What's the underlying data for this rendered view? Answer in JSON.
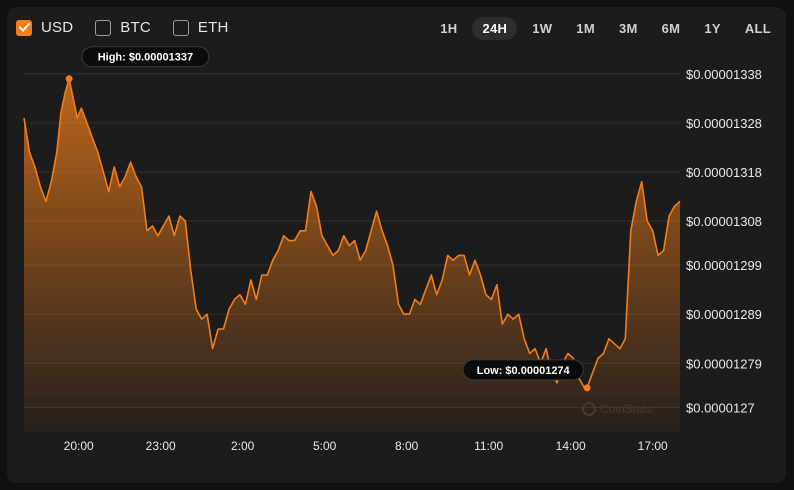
{
  "currencies": [
    {
      "label": "USD",
      "checked": true
    },
    {
      "label": "BTC",
      "checked": false
    },
    {
      "label": "ETH",
      "checked": false
    }
  ],
  "ranges": [
    "1H",
    "24H",
    "1W",
    "1M",
    "3M",
    "6M",
    "1Y",
    "ALL"
  ],
  "active_range": "24H",
  "watermark": "CoinStats",
  "colors": {
    "accent": "#f27e1a",
    "background": "#1c1c1c",
    "grid": "#2f2f2f"
  },
  "chart_data": {
    "type": "area",
    "y_tick_labels": [
      "$0.00001338",
      "$0.00001328",
      "$0.00001318",
      "$0.00001308",
      "$0.00001299",
      "$0.00001289",
      "$0.00001279",
      "$0.0000127"
    ],
    "y_tick_values": [
      1.338e-05,
      1.328e-05,
      1.318e-05,
      1.308e-05,
      1.299e-05,
      1.289e-05,
      1.279e-05,
      1.27e-05
    ],
    "x_tick_labels": [
      "20:00",
      "23:00",
      "2:00",
      "5:00",
      "8:00",
      "11:00",
      "14:00",
      "17:00"
    ],
    "x_tick_hours": [
      2,
      5,
      8,
      11,
      14,
      17,
      20,
      23
    ],
    "ylim": [
      1.265e-05,
      1.34e-05
    ],
    "xlim_hours": [
      0,
      24
    ],
    "grid": true,
    "high": {
      "label": "High: $0.00001337",
      "x_hours": 1.65,
      "value": 1.337e-05
    },
    "low": {
      "label": "Low: $0.00001274",
      "x_hours": 20.6,
      "value": 1.274e-05
    },
    "series": [
      {
        "x_hours": [
          0,
          0.2,
          0.4,
          0.6,
          0.8,
          1.0,
          1.2,
          1.35,
          1.5,
          1.65,
          1.8,
          1.95,
          2.1,
          2.3,
          2.5,
          2.7,
          2.9,
          3.1,
          3.3,
          3.5,
          3.7,
          3.9,
          4.1,
          4.3,
          4.5,
          4.7,
          4.9,
          5.1,
          5.3,
          5.5,
          5.7,
          5.9,
          6.1,
          6.3,
          6.5,
          6.7,
          6.9,
          7.1,
          7.3,
          7.5,
          7.7,
          7.9,
          8.1,
          8.3,
          8.5,
          8.7,
          8.9,
          9.1,
          9.3,
          9.5,
          9.7,
          9.9,
          10.1,
          10.3,
          10.5,
          10.7,
          10.9,
          11.1,
          11.3,
          11.5,
          11.7,
          11.9,
          12.1,
          12.3,
          12.5,
          12.7,
          12.9,
          13.1,
          13.3,
          13.5,
          13.7,
          13.9,
          14.1,
          14.3,
          14.5,
          14.7,
          14.9,
          15.1,
          15.3,
          15.5,
          15.7,
          15.9,
          16.1,
          16.3,
          16.5,
          16.7,
          16.9,
          17.1,
          17.3,
          17.5,
          17.7,
          17.9,
          18.1,
          18.3,
          18.5,
          18.7,
          18.9,
          19.1,
          19.3,
          19.5,
          19.7,
          19.9,
          20.1,
          20.3,
          20.5,
          20.6,
          20.8,
          21.0,
          21.2,
          21.4,
          21.6,
          21.8,
          22.0,
          22.2,
          22.4,
          22.6,
          22.8,
          23.0,
          23.2,
          23.4,
          23.6,
          23.8,
          24.0
        ],
        "values": [
          1.329e-05,
          1.322e-05,
          1.319e-05,
          1.315e-05,
          1.312e-05,
          1.316e-05,
          1.322e-05,
          1.33e-05,
          1.334e-05,
          1.337e-05,
          1.333e-05,
          1.329e-05,
          1.331e-05,
          1.328e-05,
          1.325e-05,
          1.322e-05,
          1.318e-05,
          1.314e-05,
          1.319e-05,
          1.315e-05,
          1.317e-05,
          1.32e-05,
          1.317e-05,
          1.315e-05,
          1.306e-05,
          1.307e-05,
          1.305e-05,
          1.307e-05,
          1.309e-05,
          1.305e-05,
          1.309e-05,
          1.308e-05,
          1.298e-05,
          1.29e-05,
          1.288e-05,
          1.289e-05,
          1.282e-05,
          1.286e-05,
          1.286e-05,
          1.29e-05,
          1.292e-05,
          1.293e-05,
          1.291e-05,
          1.296e-05,
          1.292e-05,
          1.297e-05,
          1.297e-05,
          1.3e-05,
          1.302e-05,
          1.305e-05,
          1.304e-05,
          1.304e-05,
          1.306e-05,
          1.306e-05,
          1.314e-05,
          1.311e-05,
          1.305e-05,
          1.303e-05,
          1.301e-05,
          1.302e-05,
          1.305e-05,
          1.303e-05,
          1.304e-05,
          1.3e-05,
          1.302e-05,
          1.306e-05,
          1.31e-05,
          1.306e-05,
          1.303e-05,
          1.299e-05,
          1.291e-05,
          1.289e-05,
          1.289e-05,
          1.292e-05,
          1.291e-05,
          1.294e-05,
          1.297e-05,
          1.293e-05,
          1.296e-05,
          1.301e-05,
          1.3e-05,
          1.301e-05,
          1.301e-05,
          1.297e-05,
          1.3e-05,
          1.297e-05,
          1.293e-05,
          1.292e-05,
          1.295e-05,
          1.287e-05,
          1.289e-05,
          1.288e-05,
          1.289e-05,
          1.284e-05,
          1.281e-05,
          1.282e-05,
          1.279e-05,
          1.282e-05,
          1.277e-05,
          1.275e-05,
          1.279e-05,
          1.281e-05,
          1.28e-05,
          1.276e-05,
          1.274e-05,
          1.274e-05,
          1.277e-05,
          1.28e-05,
          1.281e-05,
          1.284e-05,
          1.283e-05,
          1.282e-05,
          1.284e-05,
          1.306e-05,
          1.312e-05,
          1.316e-05,
          1.308e-05,
          1.306e-05,
          1.301e-05,
          1.302e-05,
          1.309e-05,
          1.311e-05,
          1.312e-05,
          1.317e-05
        ]
      }
    ]
  }
}
